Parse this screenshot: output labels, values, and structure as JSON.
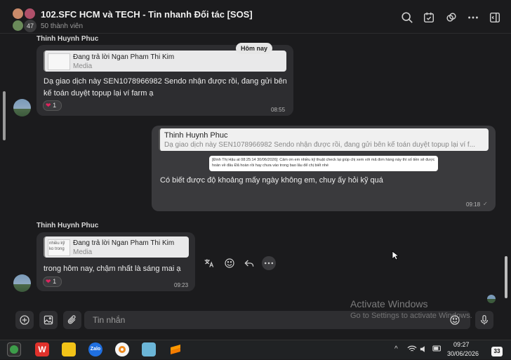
{
  "header": {
    "title": "102.SFC HCM và TECH - Tin nhanh Đối tác [SOS]",
    "members": "50 thành viên",
    "avatar_count": "47"
  },
  "date_divider": "Hôm nay",
  "messages": [
    {
      "sender": "Thinh Huynh Phuc",
      "reply_title": "Đang trả lời Ngan Pham Thi Kim",
      "reply_sub": "Media",
      "text": "Dạ giao dịch này SEN1078966982 Sendo nhận được rồi, đang gửi bên kế toán duyệt topup lại ví farm ạ",
      "reaction_count": "1",
      "time": "08:55"
    },
    {
      "reply_name": "Thinh Huynh Phuc",
      "reply_text": "Dạ giao dịch này SEN1078966982 Sendo nhận được rồi, đang gửi bên kế toán duyệt topup lại ví f...",
      "embed_text": "[Đinh Thị Hậu at 08:25:14 30/06/2026]: Cảm ơn em nhiều kỹ thuật check lại giúp chị xem với mã đơn hàng này thì số tiền sẽ được hoàn về đâu Đã hoàn rồi hay chưa vào trong bao lâu để chị biết nhé",
      "text": "Có biết được độ khoảng mấy ngày không em, chuy ấy hỏi kỹ quá",
      "time": "09:18"
    },
    {
      "sender": "Thinh Huynh Phuc",
      "reply_title": "Đang trả lời Ngan Pham Thi Kim",
      "reply_sub": "Media",
      "thumb_text": "nhiều kỹ ko trong",
      "text": "trong hôm nay, chậm nhất là sáng mai ạ",
      "reaction_count": "1",
      "time": "09:23"
    }
  ],
  "composer": {
    "placeholder": "Tin nhắn"
  },
  "watermark": {
    "line1": "Activate Windows",
    "line2": "Go to Settings to activate Windows."
  },
  "taskbar": {
    "time": "09:27",
    "date": "30/06/2026",
    "notifications": "33"
  }
}
